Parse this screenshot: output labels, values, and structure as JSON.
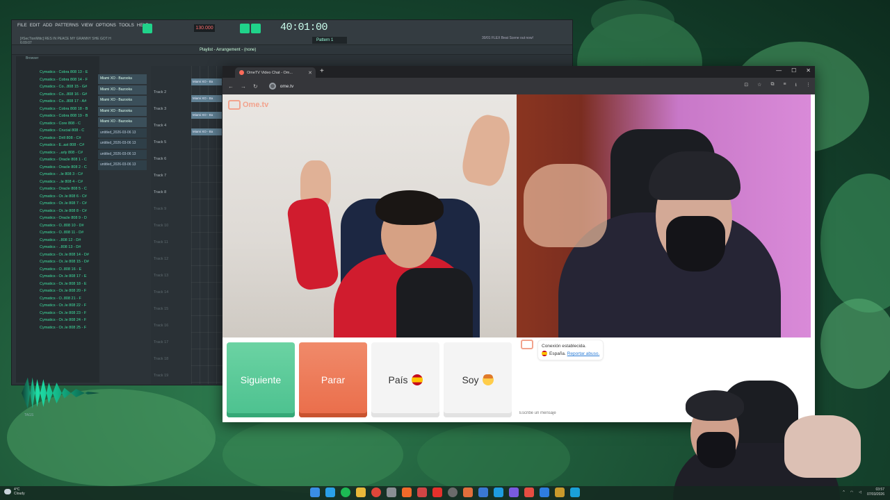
{
  "fl_studio": {
    "menus": [
      "FILE",
      "EDIT",
      "ADD",
      "PATTERNS",
      "VIEW",
      "OPTIONS",
      "TOOLS",
      "HELP"
    ],
    "song_title": "[#SecTionMitic] RES IN PEACE MY GRANNY SHE GOT H",
    "song_time": "6:09:07",
    "tempo": "130.000",
    "time_display": "40:01:00",
    "pattern": "Pattern 1",
    "flex_text": "30/01 FLEX Beat Scene out now!",
    "playlist_title": "Playlist - Arrangement - (none)",
    "browser_label": "Browser",
    "tags_label": "TAGS",
    "browser_items": [
      "Cymatics - Cobra 808 13 - E",
      "Cymatics - Cobra 808 14 - F",
      "Cymatics - Co...808 15 - G#",
      "Cymatics - Co...808 16 - G#",
      "Cymatics - Co...808 17 - A#",
      "Cymatics - Cobra 808 18 - B",
      "Cymatics - Cobra 808 19 - B",
      "Cymatics - Core 808 - C",
      "Cymatics - Crucial 808 - C",
      "Cymatics - Drill 808 - C#",
      "Cymatics - E..ast 808 - C#",
      "Cymatics - ..arly 808 - C#",
      "Cymatics - Oracle 808 1 - C",
      "Cymatics - Oracle 808 2 - C",
      "Cymatics - ..le 808 3 - C#",
      "Cymatics - ..le 808 4 - C#",
      "Cymatics - Oracle 808 5 - C",
      "Cymatics - Or..le 808 6 - C#",
      "Cymatics - Or..le 808 7 - C#",
      "Cymatics - Or..le 808 8 - C#",
      "Cymatics - Oracle 808 9 - D",
      "Cymatics - O..808 10 - D#",
      "Cymatics - O..808 11 - D#",
      "Cymatics - ..808 12 - D#",
      "Cymatics - ..808 13 - D#",
      "Cymatics - Or..le 808 14 - D#",
      "Cymatics - Or..le 808 15 - D#",
      "Cymatics - O..808 16 - E",
      "Cymatics - Or..le 808 17 - E",
      "Cymatics - Or..le 808 18 - E",
      "Cymatics - Or..le 808 20 - F",
      "Cymatics - O..808 21 - F",
      "Cymatics - Or..le 808 22 - F",
      "Cymatics - Or..le 808 23 - F",
      "Cymatics - Or..le 808 24 - F",
      "Cymatics - Or..le 808 25 - F"
    ],
    "channels": [
      "Miami XO - Bazooka",
      "Miami XO - Bazooka",
      "Miami XO - Bazooka",
      "Miami XO - Bazooka",
      "Miami XO - Bazooka",
      "untitled_2026-03-06 13",
      "untitled_2026-03-06 13",
      "untitled_2026-03-06 13",
      "untitled_2026-03-06 13"
    ],
    "tracks": [
      "Track 2",
      "Track 3",
      "Track 4",
      "Track 5",
      "Track 6",
      "Track 7",
      "Track 8",
      "Track 9",
      "Track 10",
      "Track 11",
      "Track 12",
      "Track 13",
      "Track 14",
      "Track 15",
      "Track 16",
      "Track 17",
      "Track 18",
      "Track 19"
    ],
    "clips": [
      "Miami XO - Ba",
      "Miami XO - Ba",
      "Miami XO - Ba",
      "Miami XO - Ba"
    ]
  },
  "browser": {
    "tab_title": "OmeTV Video Chat - Om...",
    "url": "ome.tv"
  },
  "ometv": {
    "logo": "Ome.tv",
    "buttons": {
      "next": "Siguiente",
      "stop": "Parar",
      "country": "País",
      "me": "Soy"
    },
    "chat": {
      "status": "Conexión establecida.",
      "country": "España.",
      "report": "Reportar abuso.",
      "placeholder": "Escribe un mensaje"
    }
  },
  "taskbar": {
    "weather_temp": "4°C",
    "weather_desc": "Cloudy",
    "time": "03:57",
    "date": "07/03/2026"
  },
  "colors": {
    "next_button": "#56c594",
    "stop_button": "#ec7451",
    "accent_green": "#20d38a"
  }
}
